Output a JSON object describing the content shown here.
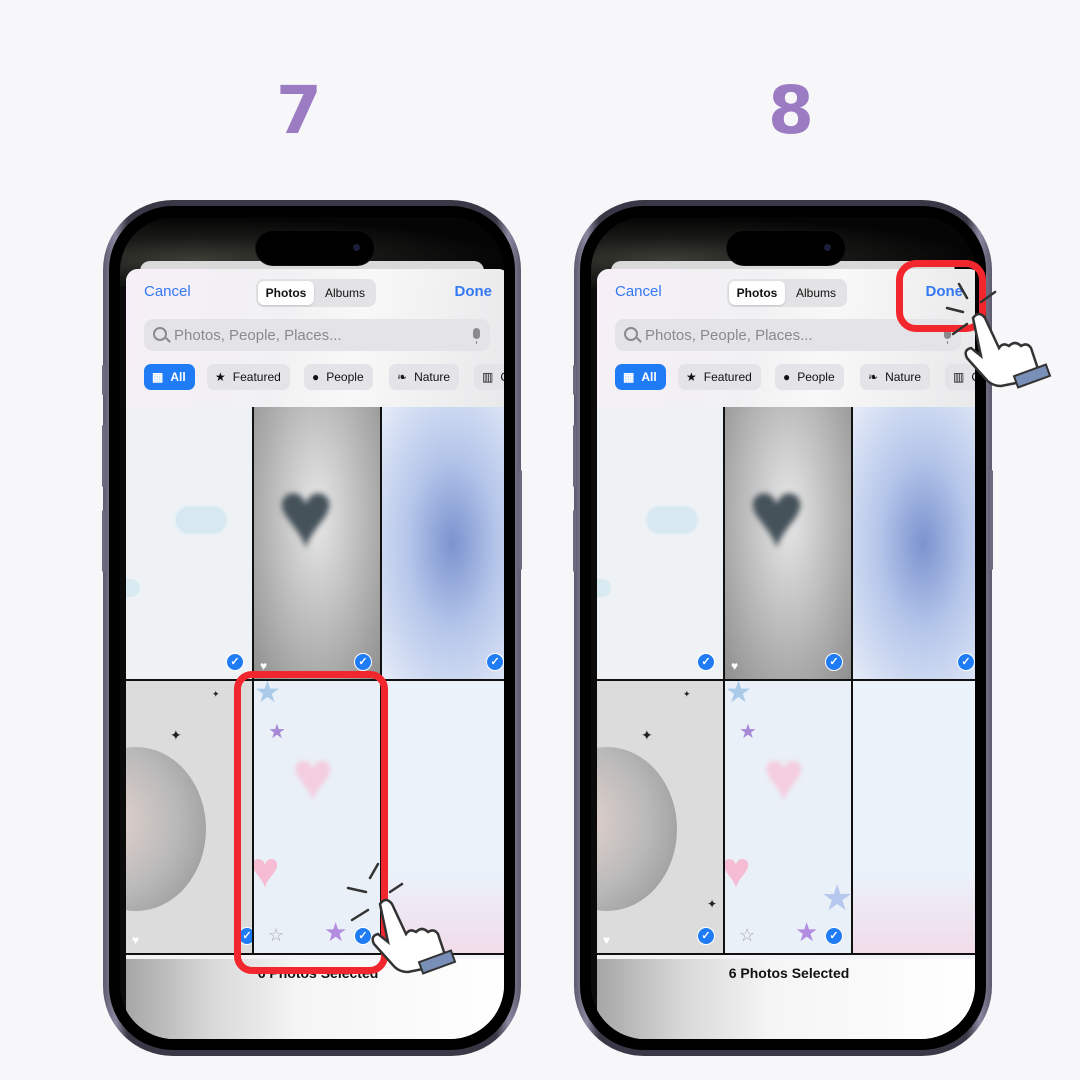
{
  "steps": [
    {
      "number": "7",
      "header": {
        "cancel": "Cancel",
        "done": "Done",
        "segments": [
          "Photos",
          "Albums"
        ],
        "selected_segment": "Photos"
      },
      "search": {
        "placeholder": "Photos, People, Places...",
        "icon": "search-icon",
        "mic_icon": "microphone-icon"
      },
      "chips": [
        {
          "label": "All",
          "icon": "grid-icon",
          "active": true
        },
        {
          "label": "Featured",
          "icon": "star-icon",
          "active": false
        },
        {
          "label": "People",
          "icon": "person-icon",
          "active": false
        },
        {
          "label": "Nature",
          "icon": "leaf-icon",
          "active": false
        },
        {
          "label": "C",
          "icon": "building-icon",
          "active": false
        }
      ],
      "photos": [
        {
          "subject": "clouds",
          "selected": true,
          "favorite": false
        },
        {
          "subject": "dark heart",
          "selected": true,
          "favorite": true
        },
        {
          "subject": "blue gradient",
          "selected": true,
          "favorite": false
        },
        {
          "subject": "planet",
          "selected": true,
          "favorite": true
        },
        {
          "subject": "pastel hearts and stars",
          "selected": true,
          "favorite": false
        },
        {
          "subject": "pastel gradient",
          "selected": false,
          "favorite": false
        }
      ],
      "footer": {
        "status": "6 Photos Selected"
      },
      "annotation": "tap highlighted photo"
    },
    {
      "number": "8",
      "header": {
        "cancel": "Cancel",
        "done": "Done",
        "segments": [
          "Photos",
          "Albums"
        ],
        "selected_segment": "Photos"
      },
      "search": {
        "placeholder": "Photos, People, Places...",
        "icon": "search-icon",
        "mic_icon": "microphone-icon"
      },
      "chips": [
        {
          "label": "All",
          "icon": "grid-icon",
          "active": true
        },
        {
          "label": "Featured",
          "icon": "star-icon",
          "active": false
        },
        {
          "label": "People",
          "icon": "person-icon",
          "active": false
        },
        {
          "label": "Nature",
          "icon": "leaf-icon",
          "active": false
        },
        {
          "label": "C",
          "icon": "building-icon",
          "active": false
        }
      ],
      "photos": [
        {
          "subject": "clouds",
          "selected": true,
          "favorite": false
        },
        {
          "subject": "dark heart",
          "selected": true,
          "favorite": true
        },
        {
          "subject": "blue gradient",
          "selected": true,
          "favorite": false
        },
        {
          "subject": "planet",
          "selected": true,
          "favorite": true
        },
        {
          "subject": "pastel hearts and stars",
          "selected": true,
          "favorite": false
        },
        {
          "subject": "pastel gradient",
          "selected": false,
          "favorite": false
        }
      ],
      "footer": {
        "status": "6 Photos Selected"
      },
      "annotation": "tap Done button"
    }
  ],
  "glyphs": {
    "check": "✓",
    "heart": "♥",
    "star": "★",
    "grid": "▦",
    "person": "●",
    "leaf": "❧",
    "building": "▥"
  },
  "colors": {
    "accent": "#3478f6",
    "step_number": "#9b7cc2",
    "highlight": "#f2272d"
  }
}
